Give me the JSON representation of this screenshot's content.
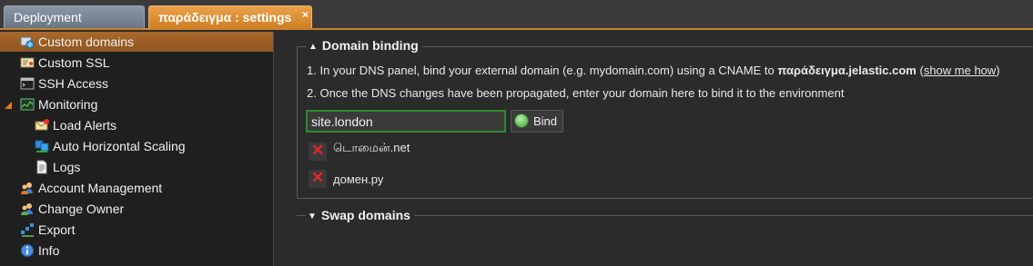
{
  "tabs": [
    {
      "label": "Deployment manager"
    },
    {
      "label": "παράδειγμα : settings",
      "close": "×"
    }
  ],
  "sidebar": {
    "items": [
      {
        "label": "Custom domains",
        "icon": "custom-domains-icon"
      },
      {
        "label": "Custom SSL",
        "icon": "ssl-certificate-icon"
      },
      {
        "label": "SSH Access",
        "icon": "terminal-icon"
      },
      {
        "label": "Monitoring",
        "icon": "monitoring-chart-icon"
      },
      {
        "label": "Load Alerts",
        "icon": "envelope-alert-icon"
      },
      {
        "label": "Auto Horizontal Scaling",
        "icon": "scaling-cubes-icon"
      },
      {
        "label": "Logs",
        "icon": "document-icon"
      },
      {
        "label": "Account Management",
        "icon": "users-icon"
      },
      {
        "label": "Change Owner",
        "icon": "users-transfer-icon"
      },
      {
        "label": "Export",
        "icon": "export-icon"
      },
      {
        "label": "Info",
        "icon": "info-icon"
      }
    ]
  },
  "domain_binding": {
    "title": "Domain binding",
    "step1_prefix": "1. In your DNS panel, bind your external domain (e.g. mydomain.com) using a CNAME to ",
    "step1_host": "παράδειγμα.jelastic.com",
    "step1_open": " (",
    "step1_link": "show me how",
    "step1_close": ")",
    "step2": "2. Once the DNS changes have been propagated, enter your domain here to bind it to the environment",
    "input_value": "site.london",
    "bind_label": "Bind",
    "domains": [
      "டொமைன்.net",
      "домен.ру"
    ]
  },
  "swap_domains": {
    "title": "Swap domains"
  },
  "colors": {
    "accent": "#c8822e",
    "selected": "#9a5f26",
    "delete": "#e2262a",
    "input_border": "#2d8a2d"
  }
}
